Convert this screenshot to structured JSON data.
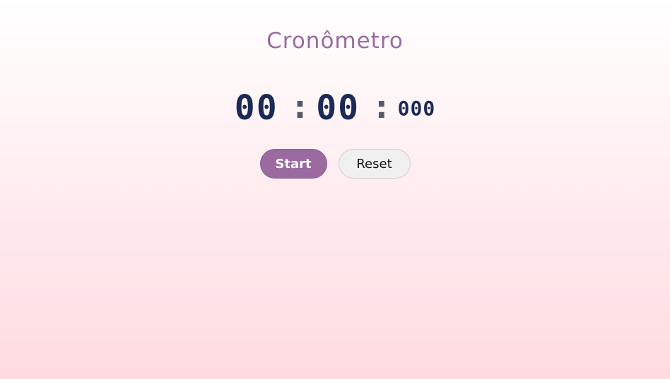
{
  "title": "Cronômetro",
  "timer": {
    "minutes": "00",
    "seconds": "00",
    "milliseconds": "000",
    "separator": ":"
  },
  "buttons": {
    "start_label": "Start",
    "reset_label": "Reset"
  },
  "colors": {
    "accent": "#9a6aa0",
    "digits": "#1b2a56",
    "reset_bg": "#f0f0f0"
  }
}
